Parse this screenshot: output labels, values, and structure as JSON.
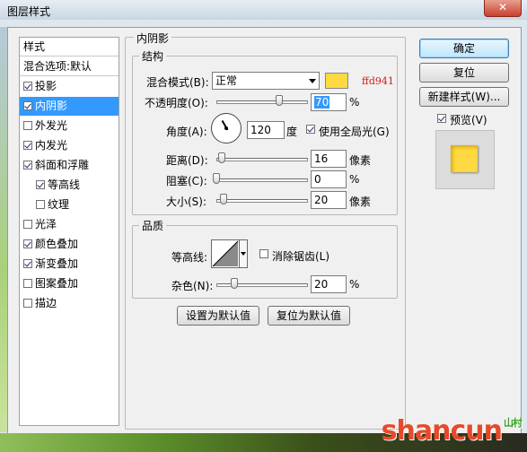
{
  "window": {
    "title": "图层样式",
    "close_glyph": "✕"
  },
  "style_list": {
    "header": "样式",
    "blend_default": "混合选项:默认",
    "items": [
      {
        "label": "投影",
        "checked": true,
        "selected": false,
        "indent": false
      },
      {
        "label": "内阴影",
        "checked": true,
        "selected": true,
        "indent": false
      },
      {
        "label": "外发光",
        "checked": false,
        "selected": false,
        "indent": false
      },
      {
        "label": "内发光",
        "checked": true,
        "selected": false,
        "indent": false
      },
      {
        "label": "斜面和浮雕",
        "checked": true,
        "selected": false,
        "indent": false
      },
      {
        "label": "等高线",
        "checked": true,
        "selected": false,
        "indent": true
      },
      {
        "label": "纹理",
        "checked": false,
        "selected": false,
        "indent": true
      },
      {
        "label": "光泽",
        "checked": false,
        "selected": false,
        "indent": false
      },
      {
        "label": "颜色叠加",
        "checked": true,
        "selected": false,
        "indent": false
      },
      {
        "label": "渐变叠加",
        "checked": true,
        "selected": false,
        "indent": false
      },
      {
        "label": "图案叠加",
        "checked": false,
        "selected": false,
        "indent": false
      },
      {
        "label": "描边",
        "checked": false,
        "selected": false,
        "indent": false
      }
    ]
  },
  "inner_shadow": {
    "title": "内阴影",
    "structure": {
      "title": "结构",
      "blend_mode_label": "混合模式(B):",
      "blend_mode_value": "正常",
      "color": "#ffd941",
      "color_note": "ffd941",
      "opacity_label": "不透明度(O):",
      "opacity_value": "70",
      "opacity_unit": "%",
      "angle_label": "角度(A):",
      "angle_value": "120",
      "angle_unit": "度",
      "global_light_label": "使用全局光(G)",
      "global_light_checked": true,
      "distance_label": "距离(D):",
      "distance_value": "16",
      "distance_unit": "像素",
      "choke_label": "阻塞(C):",
      "choke_value": "0",
      "choke_unit": "%",
      "size_label": "大小(S):",
      "size_value": "20",
      "size_unit": "像素"
    },
    "quality": {
      "title": "品质",
      "contour_label": "等高线:",
      "antialias_label": "消除锯齿(L)",
      "antialias_checked": false,
      "noise_label": "杂色(N):",
      "noise_value": "20",
      "noise_unit": "%"
    },
    "set_default_label": "设置为默认值",
    "reset_default_label": "复位为默认值"
  },
  "buttons": {
    "ok": "确定",
    "reset": "复位",
    "new_style": "新建样式(W)...",
    "preview_label": "预览(V)",
    "preview_checked": true
  },
  "watermark": {
    "text": "shancun",
    "suffix": "山村"
  }
}
